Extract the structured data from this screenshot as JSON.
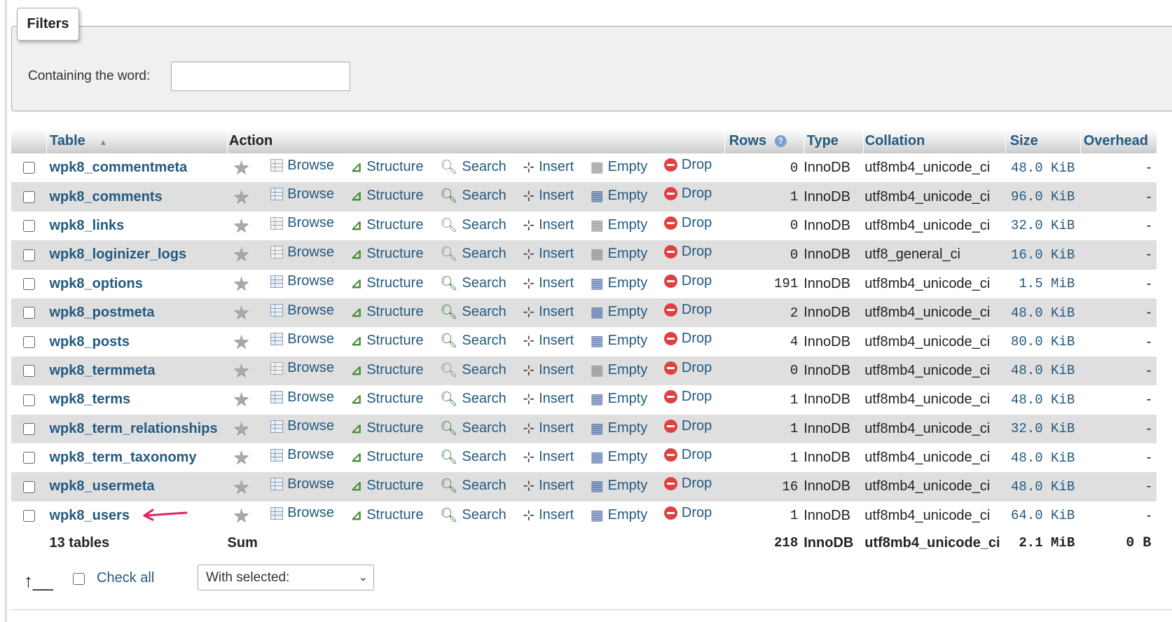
{
  "filters": {
    "legend": "Filters",
    "label": "Containing the word:",
    "value": ""
  },
  "columns": {
    "table": "Table",
    "action": "Action",
    "rows": "Rows",
    "type": "Type",
    "collation": "Collation",
    "size": "Size",
    "overhead": "Overhead"
  },
  "actions": {
    "browse": "Browse",
    "structure": "Structure",
    "search": "Search",
    "insert": "Insert",
    "empty": "Empty",
    "drop": "Drop"
  },
  "tables": [
    {
      "name": "wpk8_commentmeta",
      "rows": "0",
      "type": "InnoDB",
      "collation": "utf8mb4_unicode_ci",
      "size": "48.0 KiB",
      "overhead": "-"
    },
    {
      "name": "wpk8_comments",
      "rows": "1",
      "type": "InnoDB",
      "collation": "utf8mb4_unicode_ci",
      "size": "96.0 KiB",
      "overhead": "-"
    },
    {
      "name": "wpk8_links",
      "rows": "0",
      "type": "InnoDB",
      "collation": "utf8mb4_unicode_ci",
      "size": "32.0 KiB",
      "overhead": "-"
    },
    {
      "name": "wpk8_loginizer_logs",
      "rows": "0",
      "type": "InnoDB",
      "collation": "utf8_general_ci",
      "size": "16.0 KiB",
      "overhead": "-"
    },
    {
      "name": "wpk8_options",
      "rows": "191",
      "type": "InnoDB",
      "collation": "utf8mb4_unicode_ci",
      "size": "1.5 MiB",
      "overhead": "-"
    },
    {
      "name": "wpk8_postmeta",
      "rows": "2",
      "type": "InnoDB",
      "collation": "utf8mb4_unicode_ci",
      "size": "48.0 KiB",
      "overhead": "-"
    },
    {
      "name": "wpk8_posts",
      "rows": "4",
      "type": "InnoDB",
      "collation": "utf8mb4_unicode_ci",
      "size": "80.0 KiB",
      "overhead": "-"
    },
    {
      "name": "wpk8_termmeta",
      "rows": "0",
      "type": "InnoDB",
      "collation": "utf8mb4_unicode_ci",
      "size": "48.0 KiB",
      "overhead": "-"
    },
    {
      "name": "wpk8_terms",
      "rows": "1",
      "type": "InnoDB",
      "collation": "utf8mb4_unicode_ci",
      "size": "48.0 KiB",
      "overhead": "-"
    },
    {
      "name": "wpk8_term_relationships",
      "rows": "1",
      "type": "InnoDB",
      "collation": "utf8mb4_unicode_ci",
      "size": "32.0 KiB",
      "overhead": "-"
    },
    {
      "name": "wpk8_term_taxonomy",
      "rows": "1",
      "type": "InnoDB",
      "collation": "utf8mb4_unicode_ci",
      "size": "48.0 KiB",
      "overhead": "-"
    },
    {
      "name": "wpk8_usermeta",
      "rows": "16",
      "type": "InnoDB",
      "collation": "utf8mb4_unicode_ci",
      "size": "48.0 KiB",
      "overhead": "-"
    },
    {
      "name": "wpk8_users",
      "rows": "1",
      "type": "InnoDB",
      "collation": "utf8mb4_unicode_ci",
      "size": "64.0 KiB",
      "overhead": "-"
    }
  ],
  "summary": {
    "count": "13 tables",
    "label": "Sum",
    "rows": "218",
    "type": "InnoDB",
    "collation": "utf8mb4_unicode_ci",
    "size": "2.1 MiB",
    "overhead": "0 B"
  },
  "footer": {
    "check_all": "Check all",
    "with_selected": "With selected:"
  },
  "colors": {
    "link": "#235a81",
    "row_alt": "#dfdfdf",
    "drop_red": "#e04040",
    "annotation_arrow": "#e0245e"
  }
}
